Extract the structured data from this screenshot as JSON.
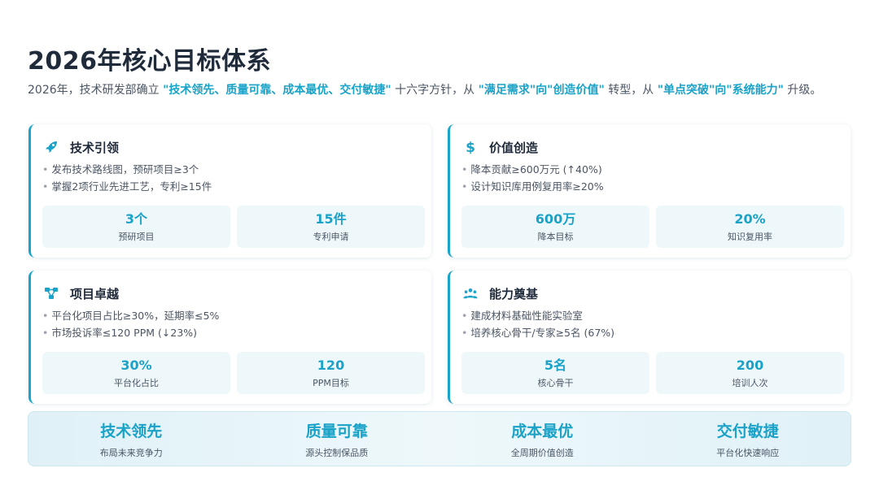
{
  "title": "2026年核心目标体系",
  "intro": {
    "p1": "2026年，技术研发部确立 ",
    "h1": "\"技术领先、质量可靠、成本最优、交付敏捷\"",
    "p2": " 十六字方针，从 ",
    "h2": "\"满足需求\"向\"创造价值\"",
    "p3": " 转型，从 ",
    "h3": "\"单点突破\"向\"系统能力\"",
    "p4": " 升级。"
  },
  "colors": {
    "accent": "#1aa2c8",
    "card_border": "#18a5c9",
    "stat_bg": "#eef8fb"
  },
  "cards": [
    {
      "icon": "rocket-icon",
      "title": "技术引领",
      "bullets": [
        "发布技术路线图，预研项目≥3个",
        "掌握2项行业先进工艺，专利≥15件"
      ],
      "stats": [
        {
          "value": "3个",
          "label": "预研项目"
        },
        {
          "value": "15件",
          "label": "专利申请"
        }
      ]
    },
    {
      "icon": "dollar-icon",
      "title": "价值创造",
      "bullets": [
        "降本贡献≥600万元 (↑40%)",
        "设计知识库用例复用率≥20%"
      ],
      "stats": [
        {
          "value": "600万",
          "label": "降本目标"
        },
        {
          "value": "20%",
          "label": "知识复用率"
        }
      ]
    },
    {
      "icon": "project-diagram-icon",
      "title": "项目卓越",
      "bullets": [
        "平台化项目占比≥30%，延期率≤5%",
        "市场投诉率≤120 PPM (↓23%)"
      ],
      "stats": [
        {
          "value": "30%",
          "label": "平台化占比"
        },
        {
          "value": "120",
          "label": "PPM目标"
        }
      ]
    },
    {
      "icon": "people-group-icon",
      "title": "能力奠基",
      "bullets": [
        "建成材料基础性能实验室",
        "培养核心骨干/专家≥5名 (67%)"
      ],
      "stats": [
        {
          "value": "5名",
          "label": "核心骨干"
        },
        {
          "value": "200",
          "label": "培训人次"
        }
      ]
    }
  ],
  "pillars": [
    {
      "title": "技术领先",
      "sub": "布局未来竞争力"
    },
    {
      "title": "质量可靠",
      "sub": "源头控制保品质"
    },
    {
      "title": "成本最优",
      "sub": "全周期价值创造"
    },
    {
      "title": "交付敏捷",
      "sub": "平台化快速响应"
    }
  ]
}
